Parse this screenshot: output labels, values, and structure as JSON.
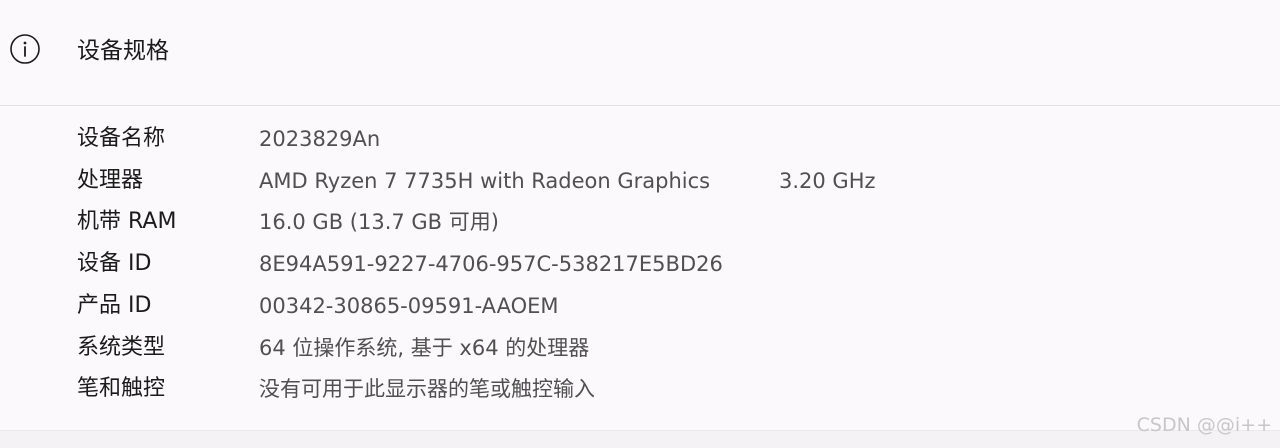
{
  "header": {
    "icon": "info-icon",
    "title": "设备规格"
  },
  "specs": [
    {
      "label": "设备名称",
      "value": "2023829An"
    },
    {
      "label": "处理器",
      "value": "AMD Ryzen 7 7735H with Radeon Graphics",
      "extra": "3.20 GHz"
    },
    {
      "label": "机带 RAM",
      "value": "16.0 GB (13.7 GB 可用)"
    },
    {
      "label": "设备 ID",
      "value": "8E94A591-9227-4706-957C-538217E5BD26"
    },
    {
      "label": "产品 ID",
      "value": "00342-30865-09591-AAOEM"
    },
    {
      "label": "系统类型",
      "value": "64 位操作系统, 基于 x64 的处理器"
    },
    {
      "label": "笔和触控",
      "value": "没有可用于此显示器的笔或触控输入"
    }
  ],
  "watermark": "CSDN @@i++"
}
